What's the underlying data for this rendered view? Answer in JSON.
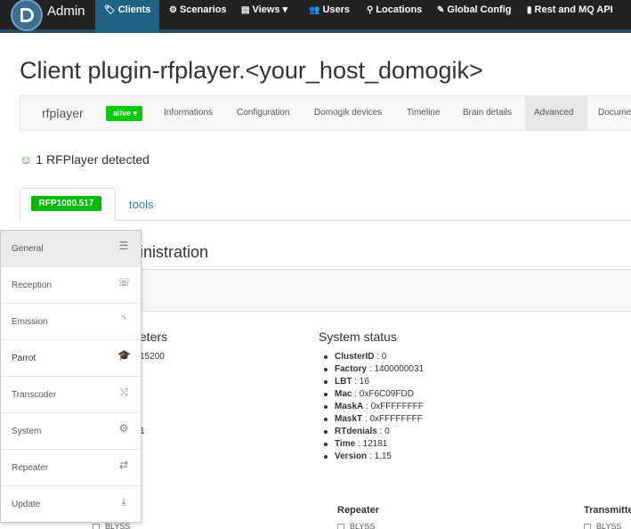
{
  "navbar": {
    "brand": "Admin",
    "items": [
      {
        "label": "Clients",
        "icon": "tags-icon"
      },
      {
        "label": "Scenarios",
        "icon": "cog-icon"
      },
      {
        "label": "Views",
        "icon": "list-icon",
        "caret": "▾"
      },
      {
        "label": "Users",
        "icon": "users-icon"
      },
      {
        "label": "Locations",
        "icon": "map-marker-icon"
      },
      {
        "label": "Global Config",
        "icon": "edit-icon"
      },
      {
        "label": "Rest and MQ API",
        "icon": "book-icon"
      }
    ]
  },
  "page": {
    "title": "Client plugin-rfplayer.<your_host_domogik>"
  },
  "subnav": {
    "brand": "rfplayer",
    "status": "alive",
    "status_caret": "▾",
    "items": [
      "Informations",
      "Configuration",
      "Domogik devices",
      "Timeline",
      "Brain details",
      "Advanced",
      "Docume"
    ]
  },
  "detected": {
    "text": "1 RFPlayer detected"
  },
  "tabs": {
    "device": "RFP1000.517",
    "tools": "tools"
  },
  "content": {
    "admin_heading": "inistration",
    "params_heading": "eters",
    "params_values": [
      "15200",
      "1"
    ],
    "system_status_heading": "System status",
    "system_status": [
      {
        "key": "ClusterID",
        "value": "0"
      },
      {
        "key": "Factory",
        "value": "1400000031"
      },
      {
        "key": "LBT",
        "value": "16"
      },
      {
        "key": "Mac",
        "value": "0xF6C09FDD"
      },
      {
        "key": "MaskA",
        "value": "0xFFFFFFFF"
      },
      {
        "key": "MaskT",
        "value": "0xFFFFFFFF"
      },
      {
        "key": "RTdenials",
        "value": "0"
      },
      {
        "key": "Time",
        "value": "12181"
      },
      {
        "key": "Version",
        "value": "1.15"
      }
    ],
    "repeater_label": "Repeater",
    "transmitter_label": "Transmitte",
    "blyss": "BLYSS"
  },
  "side_menu": {
    "items": [
      {
        "label": "General",
        "icon": "server-icon",
        "glyph": "☰"
      },
      {
        "label": "Reception",
        "icon": "phone-volume-icon",
        "glyph": "☏"
      },
      {
        "label": "Emission",
        "icon": "rss-icon",
        "glyph": "◝"
      },
      {
        "label": "Parrot",
        "icon": "graduation-cap-icon",
        "glyph": "🎓"
      },
      {
        "label": "Transcoder",
        "icon": "random-icon",
        "glyph": "⤨"
      },
      {
        "label": "System",
        "icon": "cogs-icon",
        "glyph": "⚙"
      },
      {
        "label": "Repeater",
        "icon": "retweet-icon",
        "glyph": "⇄"
      },
      {
        "label": "Update",
        "icon": "download-icon",
        "glyph": "⤓"
      }
    ]
  },
  "colors": {
    "navbar_bg": "#222222",
    "active_nav": "#1f6384",
    "alive_green": "#00cc00",
    "link_blue": "#337ab7"
  }
}
